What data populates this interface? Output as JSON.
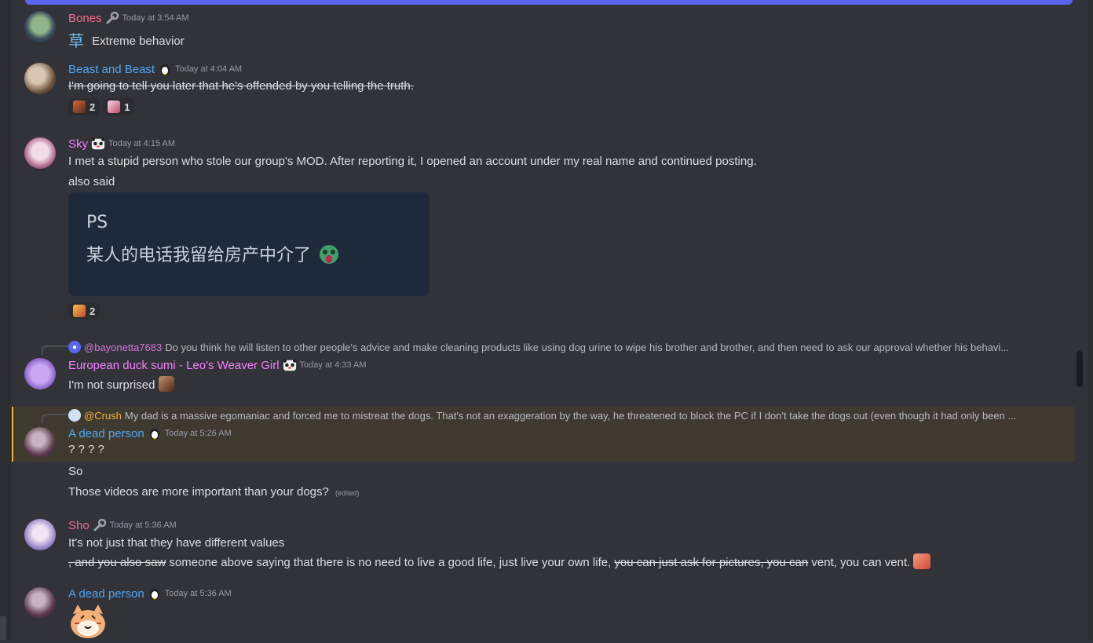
{
  "messages": {
    "m1": {
      "user": "Bones",
      "badge": "wrench-icon",
      "time": "Today at 3:54 AM",
      "emoji": "草",
      "text": "Extreme behavior",
      "name_color": "#f47fff"
    },
    "m2": {
      "user": "Beast and Beast",
      "badge": "penguin-icon",
      "time": "Today at 4:04 AM",
      "text": "I'm going to tell you later that he's offended by you telling the truth.",
      "reactions": [
        {
          "emoji": "cat-emoji",
          "count": "2"
        },
        {
          "emoji": "anime-girl-emoji",
          "count": "1"
        }
      ]
    },
    "m3": {
      "user": "Sky",
      "badge": "panda-icon",
      "time": "Today at 4:15 AM",
      "line1": "I met a stupid person who stole our group's MOD. After reporting it, I opened an account under my real name and continued posting.",
      "line2": "also said",
      "embed": {
        "line1": "PS",
        "line2": "某人的电话我留给房产中介了"
      },
      "reactions": [
        {
          "emoji": "fox-emoji",
          "count": "2"
        }
      ]
    },
    "m4": {
      "reply_user": "@bayonetta7683",
      "reply_text": "Do you think he will listen to other people's advice and make cleaning products like using dog urine to wipe his brother and brother, and then need to ask our approval whether his behavi...",
      "user": "European duck sumi - Leo's Weaver Girl",
      "badge": "panda-icon",
      "time": "Today at 4:33 AM",
      "text": "I'm not surprised"
    },
    "m5": {
      "reply_user": "@Crush",
      "reply_text": "My dad is a massive egomaniac and forced me to mistreat the dogs. That's not an exaggeration by the way, he threatened to block the PC if I don't take the dogs out (even though it had only been ...",
      "user": "A dead person",
      "badge": "penguin-icon",
      "time": "Today at 5:26 AM",
      "text": "? ? ? ?",
      "line2": "So",
      "line3": "Those videos are more important than your dogs?",
      "edited": "(edited)"
    },
    "m6": {
      "user": "Sho",
      "badge": "wrench-icon",
      "time": "Today at 5:36 AM",
      "line1": "It's not just that they have different values",
      "p1_strike": ", and you also saw",
      "p2": " someone above saying that there is no need to live a good life, just live your own life, ",
      "p3_strike": "you can just ask for pictures, you can",
      "p4": " vent, you can vent."
    },
    "m7": {
      "user": "A dead person",
      "badge": "penguin-icon",
      "time": "Today at 5:36 AM",
      "sticker": "tiger-sticker"
    }
  },
  "colors": {
    "accent": "#5865f2",
    "mention_bg": "#3f3a30",
    "mention_border": "#f0b232",
    "pink": "#f47fff",
    "blue": "#4ea6f5",
    "red_name": "#f06c8c"
  }
}
